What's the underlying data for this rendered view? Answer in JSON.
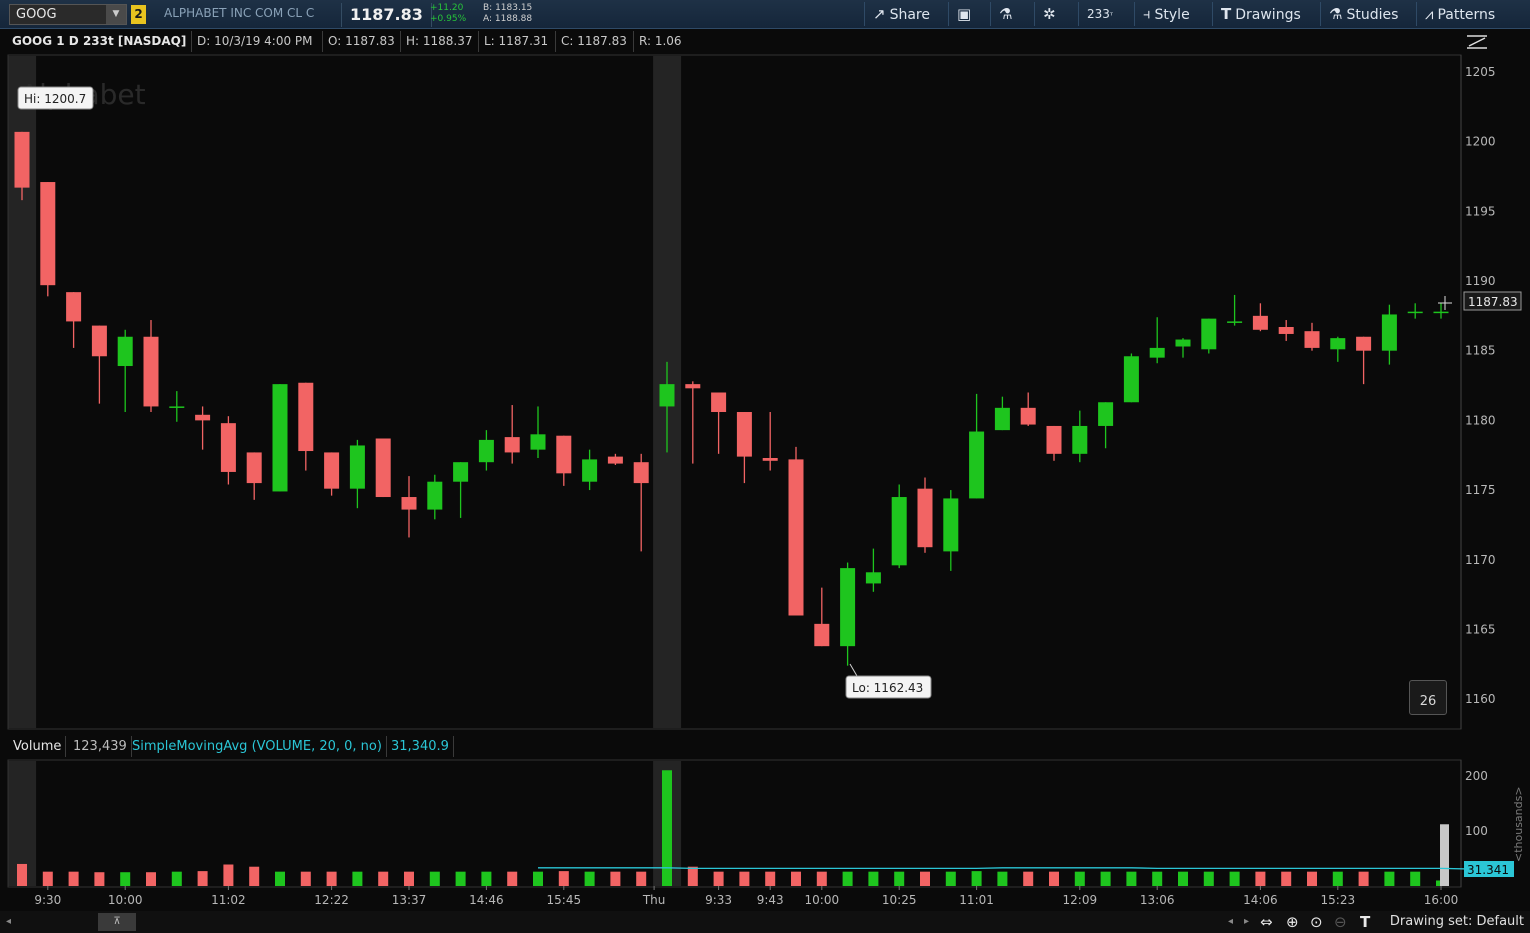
{
  "toolbar": {
    "symbol": "GOOG",
    "link_badge": "2",
    "description": "ALPHABET INC COM CL C",
    "last_price": "1187.83",
    "net_change": "+11.20",
    "pct_change": "+0.95%",
    "bid": "B: 1183.15",
    "ask": "A: 1188.88",
    "share_label": "Share",
    "aggregation": "233",
    "style_label": "Style",
    "drawings_label": "Drawings",
    "studies_label": "Studies",
    "patterns_label": "Patterns"
  },
  "infobar": {
    "symbol": "GOOG 1 D 233t [NASDAQ]",
    "date": "D: 10/3/19 4:00 PM",
    "open": "O: 1187.83",
    "high": "H: 1188.37",
    "low": "L: 1187.31",
    "close": "C: 1187.83",
    "range": "R: 1.06"
  },
  "watermark": "Alphabet",
  "hi_label": "Hi: 1200.7",
  "lo_label": "Lo: 1162.43",
  "last_price_tag": "1187.83",
  "corner_badge": "26",
  "volume_header": {
    "label": "Volume",
    "value": "123,439",
    "study": "SimpleMovingAvg (VOLUME, 20, 0, no)",
    "study_value": "31,340.9"
  },
  "volume_axis_unit": "<thousands>",
  "volume_tag": "31.341",
  "bottom": {
    "drawing_set": "Drawing set: Default"
  },
  "colors": {
    "up": "#1ec51e",
    "down": "#f26464",
    "sma": "#2bc6d6",
    "background": "#0a0a0a",
    "session_break": "#3a3a3a"
  },
  "chart_data": [
    {
      "type": "candlestick",
      "title": "GOOG 1 D 233t [NASDAQ]",
      "ylim": [
        1158,
        1206
      ],
      "yticks": [
        1160,
        1165,
        1170,
        1175,
        1180,
        1185,
        1190,
        1195,
        1200,
        1205
      ],
      "xtick_labels": [
        "9:30",
        "10:00",
        "11:02",
        "12:22",
        "13:37",
        "14:46",
        "15:45",
        "Thu",
        "9:33",
        "9:43",
        "10:00",
        "10:25",
        "11:01",
        "12:09",
        "13:06",
        "14:06",
        "15:23",
        "16:00"
      ],
      "xtick_index": [
        1,
        4,
        8,
        12,
        15,
        18,
        21,
        24.5,
        27,
        29,
        31,
        34,
        37,
        41,
        44,
        48,
        51,
        55
      ],
      "session_breaks": [
        0,
        25
      ],
      "candles": [
        {
          "o": 1200.7,
          "h": 1200.7,
          "l": 1195.8,
          "c": 1196.7
        },
        {
          "o": 1197.1,
          "h": 1197.1,
          "l": 1188.9,
          "c": 1189.7
        },
        {
          "o": 1189.2,
          "h": 1189.2,
          "l": 1185.2,
          "c": 1187.1
        },
        {
          "o": 1186.8,
          "h": 1186.8,
          "l": 1181.2,
          "c": 1184.6
        },
        {
          "o": 1183.9,
          "h": 1186.5,
          "l": 1180.6,
          "c": 1186.0
        },
        {
          "o": 1186.0,
          "h": 1187.2,
          "l": 1180.6,
          "c": 1181.0
        },
        {
          "o": 1180.9,
          "h": 1182.1,
          "l": 1179.9,
          "c": 1181.0
        },
        {
          "o": 1180.4,
          "h": 1181.0,
          "l": 1177.9,
          "c": 1180.0
        },
        {
          "o": 1179.8,
          "h": 1180.3,
          "l": 1175.4,
          "c": 1176.3
        },
        {
          "o": 1177.7,
          "h": 1177.7,
          "l": 1174.3,
          "c": 1175.5
        },
        {
          "o": 1174.9,
          "h": 1182.6,
          "l": 1174.9,
          "c": 1182.6
        },
        {
          "o": 1182.7,
          "h": 1182.7,
          "l": 1176.4,
          "c": 1177.8
        },
        {
          "o": 1177.7,
          "h": 1177.7,
          "l": 1174.6,
          "c": 1175.1
        },
        {
          "o": 1175.1,
          "h": 1178.6,
          "l": 1173.7,
          "c": 1178.2
        },
        {
          "o": 1178.7,
          "h": 1178.7,
          "l": 1174.5,
          "c": 1174.5
        },
        {
          "o": 1174.5,
          "h": 1176.0,
          "l": 1171.6,
          "c": 1173.6
        },
        {
          "o": 1173.6,
          "h": 1176.1,
          "l": 1172.9,
          "c": 1175.6
        },
        {
          "o": 1175.6,
          "h": 1177.0,
          "l": 1173.0,
          "c": 1177.0
        },
        {
          "o": 1177.0,
          "h": 1179.3,
          "l": 1176.4,
          "c": 1178.6
        },
        {
          "o": 1178.8,
          "h": 1181.1,
          "l": 1176.9,
          "c": 1177.7
        },
        {
          "o": 1177.9,
          "h": 1181.0,
          "l": 1177.3,
          "c": 1179.0
        },
        {
          "o": 1178.9,
          "h": 1178.9,
          "l": 1175.3,
          "c": 1176.2
        },
        {
          "o": 1175.6,
          "h": 1177.9,
          "l": 1175.0,
          "c": 1177.2
        },
        {
          "o": 1177.4,
          "h": 1177.6,
          "l": 1176.8,
          "c": 1176.9
        },
        {
          "o": 1177.0,
          "h": 1177.6,
          "l": 1170.6,
          "c": 1175.5
        },
        {
          "o": 1181.0,
          "h": 1184.2,
          "l": 1177.7,
          "c": 1182.6
        },
        {
          "o": 1182.6,
          "h": 1182.8,
          "l": 1176.9,
          "c": 1182.3
        },
        {
          "o": 1182.0,
          "h": 1182.0,
          "l": 1177.6,
          "c": 1180.6
        },
        {
          "o": 1180.6,
          "h": 1180.6,
          "l": 1175.5,
          "c": 1177.4
        },
        {
          "o": 1177.3,
          "h": 1180.6,
          "l": 1176.4,
          "c": 1177.1
        },
        {
          "o": 1177.2,
          "h": 1178.1,
          "l": 1166.0,
          "c": 1166.0
        },
        {
          "o": 1165.4,
          "h": 1168.0,
          "l": 1163.8,
          "c": 1163.8
        },
        {
          "o": 1163.8,
          "h": 1169.8,
          "l": 1162.4,
          "c": 1169.4
        },
        {
          "o": 1168.3,
          "h": 1170.8,
          "l": 1167.7,
          "c": 1169.1
        },
        {
          "o": 1169.6,
          "h": 1175.4,
          "l": 1169.4,
          "c": 1174.5
        },
        {
          "o": 1175.1,
          "h": 1175.9,
          "l": 1170.5,
          "c": 1170.9
        },
        {
          "o": 1170.6,
          "h": 1175.0,
          "l": 1169.2,
          "c": 1174.4
        },
        {
          "o": 1174.4,
          "h": 1181.9,
          "l": 1174.4,
          "c": 1179.2
        },
        {
          "o": 1179.3,
          "h": 1181.7,
          "l": 1179.3,
          "c": 1180.9
        },
        {
          "o": 1180.9,
          "h": 1182.0,
          "l": 1179.6,
          "c": 1179.7
        },
        {
          "o": 1179.6,
          "h": 1179.6,
          "l": 1177.1,
          "c": 1177.6
        },
        {
          "o": 1177.6,
          "h": 1180.7,
          "l": 1177.0,
          "c": 1179.6
        },
        {
          "o": 1179.6,
          "h": 1181.3,
          "l": 1178.0,
          "c": 1181.3
        },
        {
          "o": 1181.3,
          "h": 1184.8,
          "l": 1181.3,
          "c": 1184.6
        },
        {
          "o": 1184.5,
          "h": 1187.4,
          "l": 1184.1,
          "c": 1185.2
        },
        {
          "o": 1185.3,
          "h": 1185.9,
          "l": 1184.5,
          "c": 1185.8
        },
        {
          "o": 1185.1,
          "h": 1187.3,
          "l": 1184.8,
          "c": 1187.3
        },
        {
          "o": 1187.0,
          "h": 1189.0,
          "l": 1186.8,
          "c": 1187.1
        },
        {
          "o": 1187.5,
          "h": 1188.4,
          "l": 1186.4,
          "c": 1186.5
        },
        {
          "o": 1186.7,
          "h": 1187.2,
          "l": 1185.7,
          "c": 1186.2
        },
        {
          "o": 1186.4,
          "h": 1187.0,
          "l": 1185.0,
          "c": 1185.2
        },
        {
          "o": 1185.1,
          "h": 1186.0,
          "l": 1184.2,
          "c": 1185.9
        },
        {
          "o": 1186.0,
          "h": 1186.0,
          "l": 1182.6,
          "c": 1185.0
        },
        {
          "o": 1185.0,
          "h": 1188.3,
          "l": 1184.0,
          "c": 1187.6
        },
        {
          "o": 1187.8,
          "h": 1188.4,
          "l": 1187.3,
          "c": 1187.8
        },
        {
          "o": 1187.8,
          "h": 1188.4,
          "l": 1187.3,
          "c": 1187.8
        }
      ]
    },
    {
      "type": "bar",
      "title": "Volume",
      "unit": "thousands",
      "ylim": [
        0,
        225
      ],
      "yticks": [
        100,
        200
      ],
      "values": [
        40,
        26,
        26,
        25,
        25,
        25,
        26,
        27,
        39,
        35,
        26,
        26,
        26,
        26,
        26,
        26,
        26,
        26,
        26,
        26,
        26,
        27,
        26,
        26,
        26,
        210,
        35,
        26,
        26,
        26,
        26,
        26,
        26,
        26,
        26,
        26,
        26,
        27,
        26,
        26,
        26,
        26,
        26,
        26,
        26,
        26,
        26,
        26,
        26,
        26,
        26,
        26,
        26,
        26,
        26,
        10,
        112
      ],
      "sma_series": {
        "name": "SimpleMovingAvg (VOLUME, 20, 0, no)",
        "values": [
          null,
          null,
          null,
          null,
          null,
          null,
          null,
          null,
          null,
          null,
          null,
          null,
          null,
          null,
          null,
          null,
          null,
          null,
          null,
          null,
          33,
          33,
          33,
          33,
          33,
          33,
          32,
          32,
          32,
          32,
          32,
          32,
          32,
          32,
          32,
          32,
          32,
          32,
          33,
          33,
          33,
          33,
          33,
          33,
          32,
          32,
          32,
          32,
          32,
          32,
          32,
          32,
          32,
          32,
          32,
          32,
          31
        ]
      }
    }
  ]
}
